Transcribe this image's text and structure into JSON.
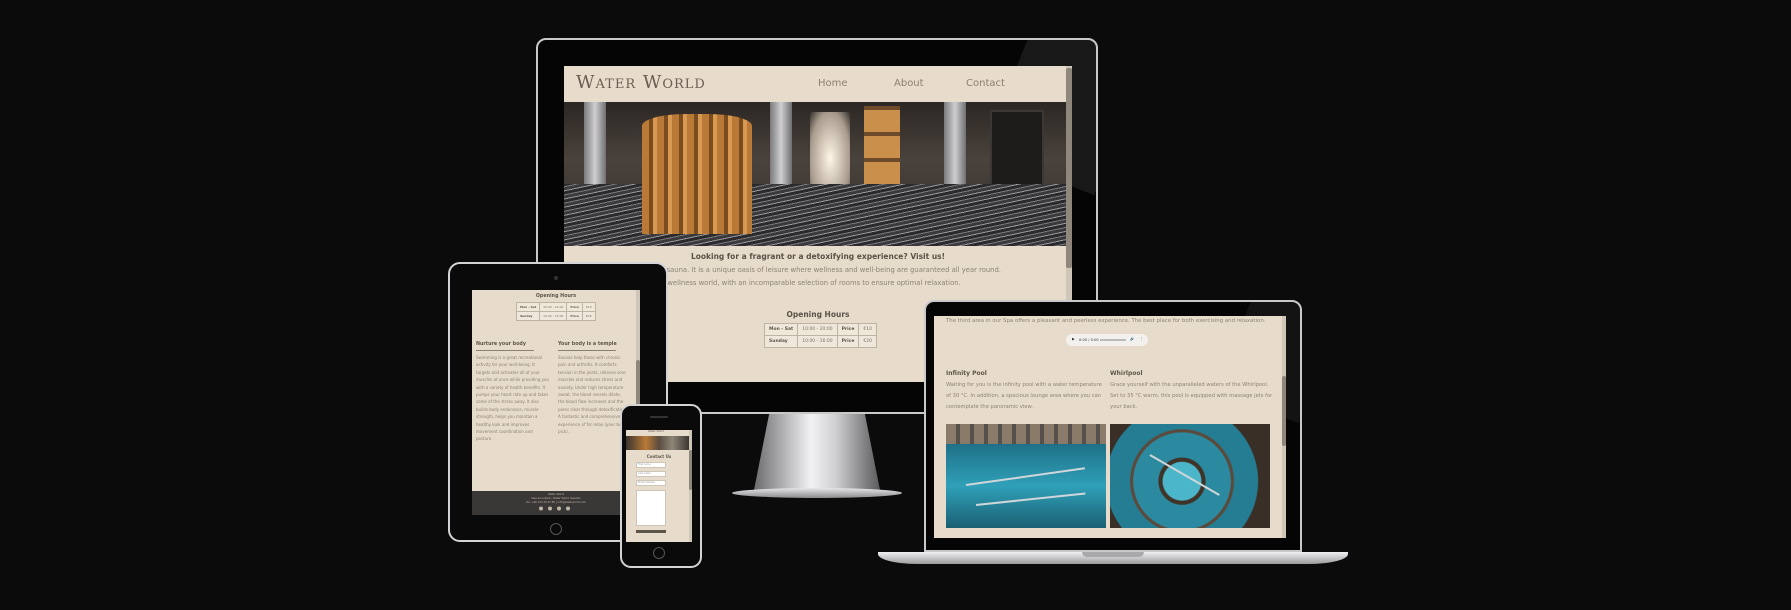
{
  "site": {
    "logo": "Water World",
    "nav": [
      "Home",
      "About",
      "Contact"
    ]
  },
  "desktop": {
    "tagline": "Looking for a fragrant or a detoxifying experience? Visit us!",
    "intro_1": "...n pool and sauna. It is a unique oasis of leisure where wellness and well-being are guaranteed all year round.",
    "intro_2": "...our unique wellness world, with an incomparable selection of rooms to ensure optimal relaxation.",
    "hours_title": "Opening Hours",
    "hours": [
      {
        "days": "Mon - Sat",
        "time": "10:00 - 20:00",
        "price_label": "Price",
        "price": "€10"
      },
      {
        "days": "Sunday",
        "time": "10:00 - 16:00",
        "price_label": "Price",
        "price": "€20"
      }
    ]
  },
  "tablet": {
    "hours_title": "Opening Hours",
    "hours": [
      {
        "days": "Mon - Sat",
        "time": "10:00 - 20:00",
        "price_label": "Price",
        "price": "€10"
      },
      {
        "days": "Sunday",
        "time": "10:00 - 16:00",
        "price_label": "Price",
        "price": "€20"
      }
    ],
    "col1_title": "Nurture your body",
    "col1_text": "Swimming is a great recreational activity for your well-being. It targets and activates all of your muscles at once while providing you with a variety of health benefits. It pumps your heart rate up and takes some of the stress away. It also builds body endurance, muscle strength, helps you maintain a healthy look and improves movement coordination and posture.",
    "col2_title": "Your body is a temple",
    "col2_text": "Saunas help those with chronic pain and arthritis. It comforts tension in the joints, relieves sore muscles and reduces stress and anxiety. Under high temperature sweat, the blood vessels dilate, the blood flow increases and the pores clear through detoxification. A fantastic and comprehensive experience of for relax (your best pick).",
    "footer_line1": "Water World",
    "footer_line2": "Sauna Location, Water World, Sweden",
    "footer_line3": "Tel: +46 123 45 67 89  |  info@waterworld.com"
  },
  "phone": {
    "title": "Contact Us",
    "fields": [
      "First name",
      "Last name",
      "Email address"
    ],
    "logo": "Water World"
  },
  "laptop": {
    "intro": "The third area in our Spa offers a pleasant and peerless experience. The best place for both exercising and relaxation.",
    "audio_time": "0:00 / 0:00",
    "col1_title": "Infinity Pool",
    "col1_text": "Waiting for you is the infinity pool with a water temperature of 30 °C. In addition, a spacious lounge area where you can contemplate the panoramic view.",
    "col2_title": "Whirlpool",
    "col2_text": "Grace yourself with the unparalleled waters of the Whirlpool. Set to 35 °C warm, this pool is equipped with massage jets for your back."
  },
  "colors": {
    "background": "#0c0b0c",
    "page": "#e7dccb",
    "text": "#8c8375",
    "heading": "#5e5549"
  }
}
